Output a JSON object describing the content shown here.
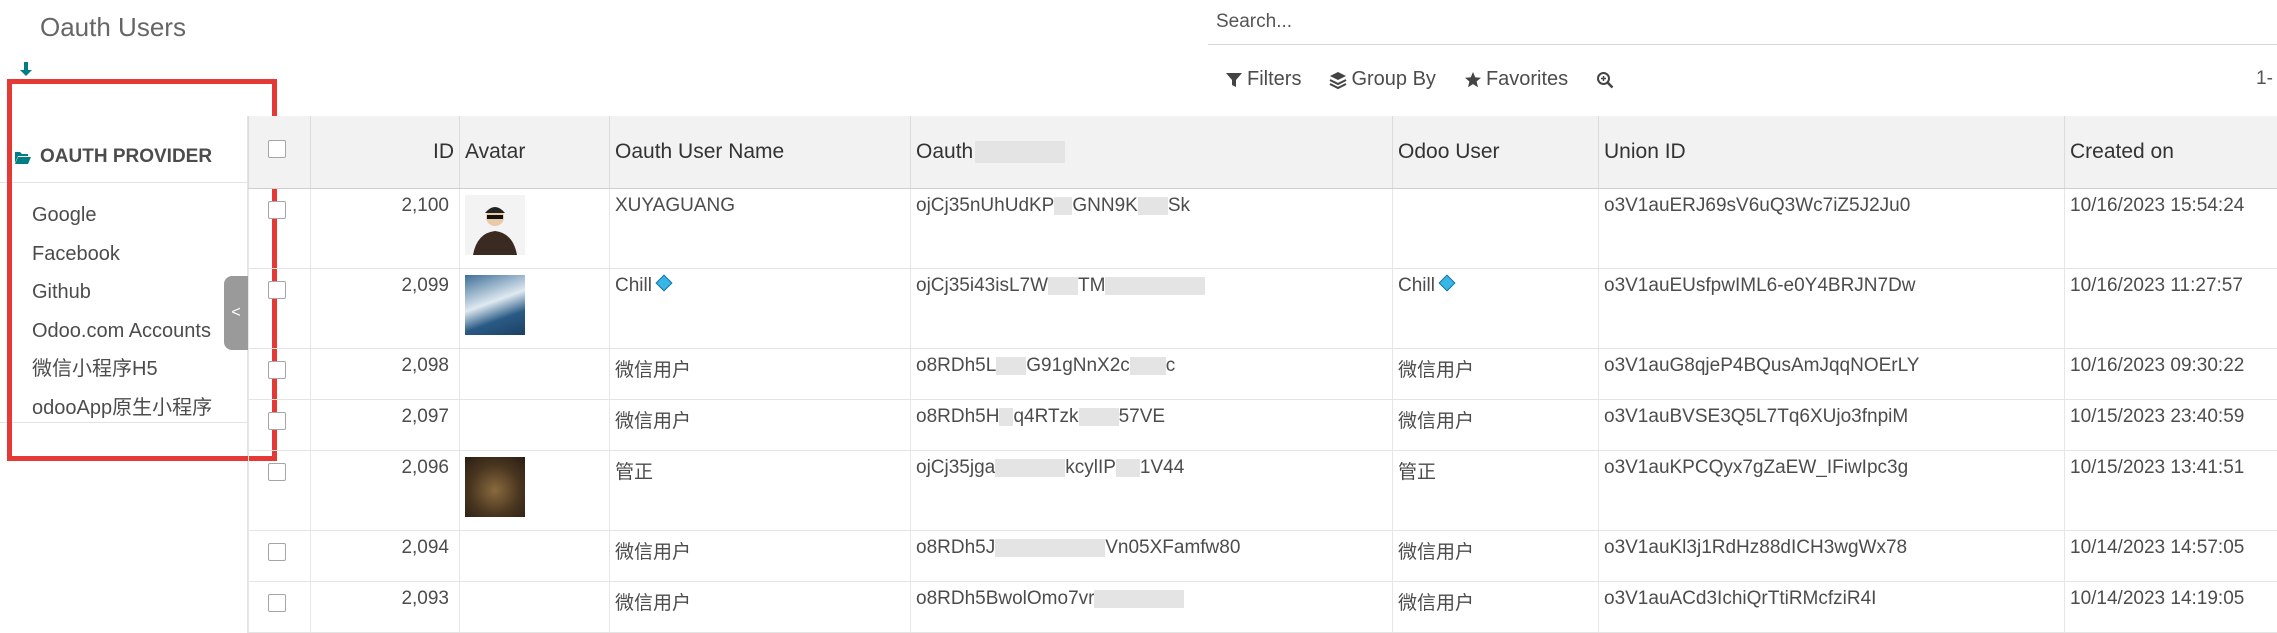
{
  "page_title": "Oauth Users",
  "search": {
    "placeholder": "Search..."
  },
  "facets": {
    "filters": "Filters",
    "group_by": "Group By",
    "favorites": "Favorites"
  },
  "pager": "1-",
  "sidebar": {
    "heading": "OAUTH PROVIDER",
    "items": [
      "Google",
      "Facebook",
      "Github",
      "Odoo.com Accounts",
      "微信小程序H5",
      "odooApp原生小程序"
    ],
    "collapse_glyph": "<"
  },
  "table": {
    "columns": {
      "id": "ID",
      "avatar": "Avatar",
      "oauth_user_name": "Oauth User Name",
      "oauth_uid": "Oauth",
      "odoo_user": "Odoo User",
      "union_id": "Union ID",
      "created_on": "Created on"
    },
    "rows": [
      {
        "id": "2,100",
        "avatar": "person",
        "name": "XUYAGUANG",
        "oauth": "ojCj35nUhUdKP",
        "oauth_tail": "GNN9K",
        "oauth_end": "Sk",
        "odoo_user": "",
        "union_id": "o3V1auERJ69sV6uQ3Wc7iZ5J2Ju0",
        "created": "10/16/2023 15:54:24"
      },
      {
        "id": "2,099",
        "avatar": "sea",
        "name": "Chill",
        "name_badge": true,
        "oauth": "ojCj35i43isL7W",
        "oauth_tail": "TM",
        "oauth_end": "",
        "odoo_user": "Chill",
        "odoo_badge": true,
        "union_id": "o3V1auEUsfpwIML6-e0Y4BRJN7Dw",
        "created": "10/16/2023 11:27:57"
      },
      {
        "id": "2,098",
        "avatar": "",
        "name": "微信用户",
        "oauth": "o8RDh5L",
        "oauth_tail": "G91gNnX2c",
        "oauth_end": "c",
        "odoo_user": "微信用户",
        "union_id": "o3V1auG8qjeP4BQusAmJqqNOErLY",
        "created": "10/16/2023 09:30:22"
      },
      {
        "id": "2,097",
        "avatar": "",
        "name": "微信用户",
        "oauth": "o8RDh5H",
        "oauth_tail": "q4RTzk",
        "oauth_end": "57VE",
        "odoo_user": "微信用户",
        "union_id": "o3V1auBVSE3Q5L7Tq6XUjo3fnpiM",
        "created": "10/15/2023 23:40:59"
      },
      {
        "id": "2,096",
        "avatar": "food",
        "name": "管正",
        "oauth": "ojCj35jga",
        "oauth_tail": "kcylIP",
        "oauth_end": "1V44",
        "odoo_user": "管正",
        "union_id": "o3V1auKPCQyx7gZaEW_IFiwIpc3g",
        "created": "10/15/2023 13:41:51"
      },
      {
        "id": "2,094",
        "avatar": "",
        "name": "微信用户",
        "oauth": "o8RDh5J",
        "oauth_tail": "Vn05XFamfw80",
        "oauth_end": "",
        "odoo_user": "微信用户",
        "union_id": "o3V1auKl3j1RdHz88dICH3wgWx78",
        "created": "10/14/2023 14:57:05"
      },
      {
        "id": "2,093",
        "avatar": "",
        "name": "微信用户",
        "oauth": "o8RDh5BwolOmo7vr",
        "oauth_tail": "",
        "oauth_end": "",
        "odoo_user": "微信用户",
        "union_id": "o3V1auACd3IchiQrTtiRMcfziR4I",
        "created": "10/14/2023 14:19:05"
      }
    ]
  },
  "colors": {
    "highlight_border": "#e53935",
    "accent": "#017e84",
    "header_bg": "#f2f2f2",
    "badge": "#39b6e8"
  }
}
